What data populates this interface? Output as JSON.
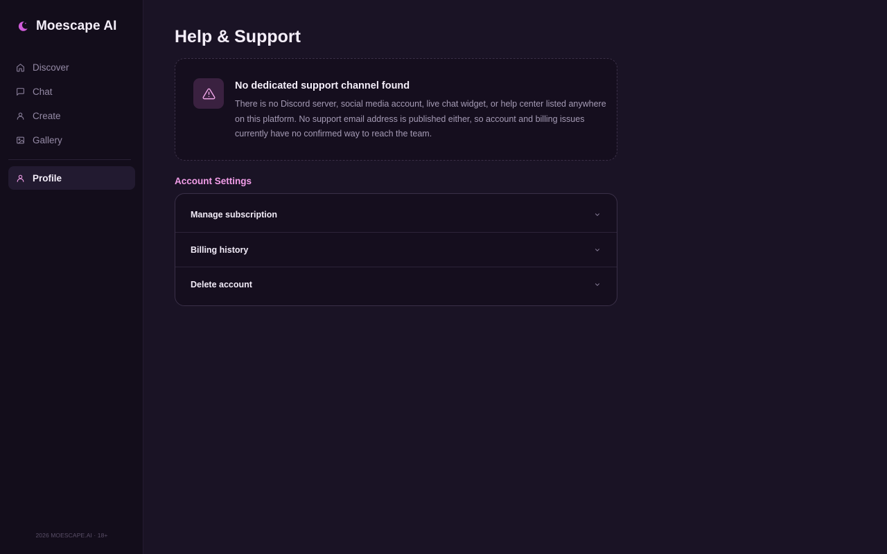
{
  "sidebar": {
    "brand": {
      "name": "Moescape AI",
      "icon": "crescent-moon-icon",
      "icon_color": "#d05cd9"
    },
    "nav": [
      {
        "label": "Discover",
        "icon": "home-icon"
      },
      {
        "label": "Chat",
        "icon": "chat-bubble-icon"
      },
      {
        "label": "Create",
        "icon": "person-icon"
      },
      {
        "label": "Gallery",
        "icon": "image-icon"
      }
    ],
    "active_item": {
      "label": "Profile",
      "icon": "person-icon",
      "icon_color": "#f39ee9"
    },
    "footer": "2026 MOESCAPE.AI · 18+"
  },
  "main": {
    "title": "Help & Support",
    "alert": {
      "icon": "warning-triangle-icon",
      "title": "No dedicated support channel found",
      "body": "There is no Discord server, social media account, live chat widget, or help center listed anywhere on this platform. No support email address is published either, so account and billing issues currently have no confirmed way to reach the team."
    },
    "account_settings": {
      "title": "Account Settings",
      "rows": [
        {
          "label": "Manage subscription",
          "icon": "chevron-down-icon"
        },
        {
          "label": "Billing history",
          "icon": "chevron-down-icon"
        },
        {
          "label": "Delete account",
          "icon": "chevron-down-icon"
        }
      ]
    }
  },
  "colors": {
    "background": "#1a1325",
    "sidebar": "#130d1b",
    "accent": "#f39ee9",
    "muted_text": "#958aa6"
  }
}
